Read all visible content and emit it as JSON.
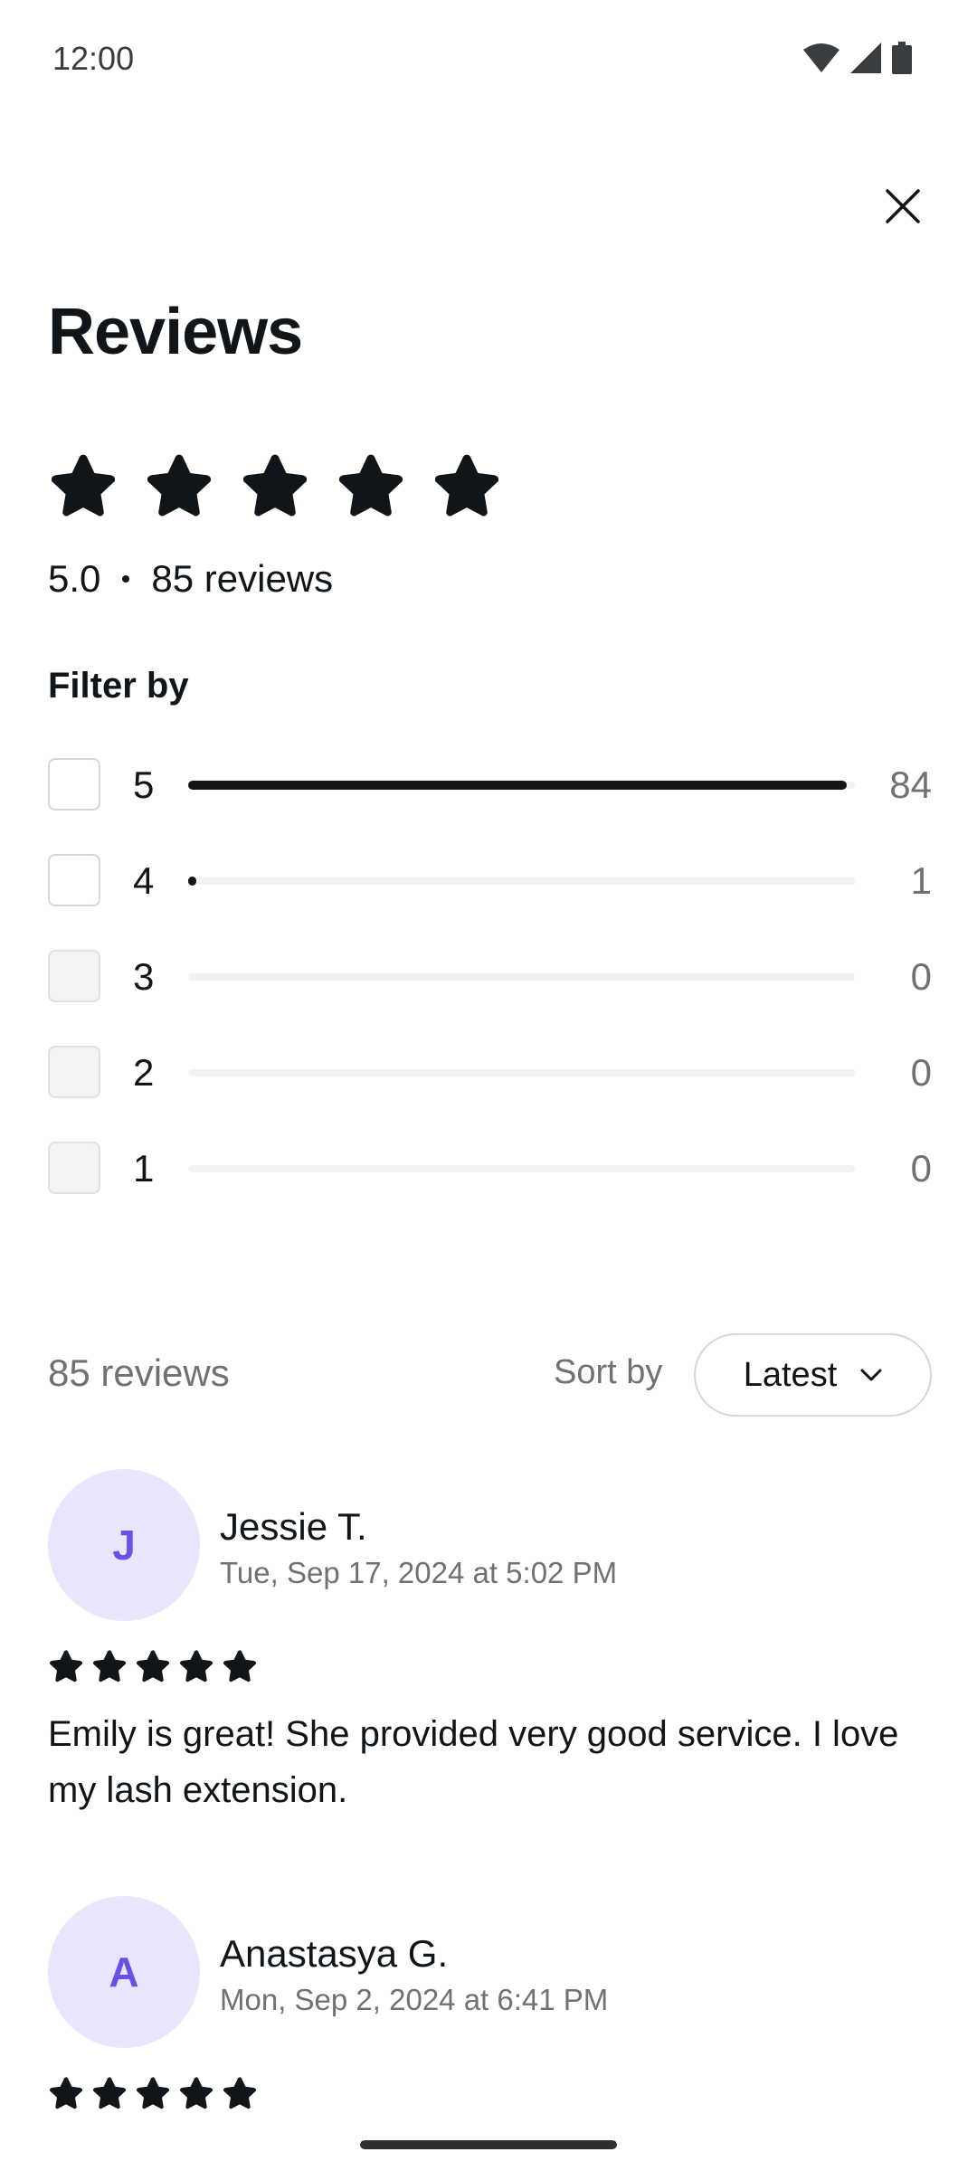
{
  "status": {
    "time": "12:00"
  },
  "header": {
    "title": "Reviews"
  },
  "rating_summary": {
    "rating": "5.0",
    "reviews_label": "85 reviews",
    "stars": 5
  },
  "filter": {
    "title": "Filter by",
    "rows": [
      {
        "stars": "5",
        "count": "84",
        "fraction": 0.988,
        "enabled": true
      },
      {
        "stars": "4",
        "count": "1",
        "fraction": 0.012,
        "enabled": true
      },
      {
        "stars": "3",
        "count": "0",
        "fraction": 0,
        "enabled": false
      },
      {
        "stars": "2",
        "count": "0",
        "fraction": 0,
        "enabled": false
      },
      {
        "stars": "1",
        "count": "0",
        "fraction": 0,
        "enabled": false
      }
    ]
  },
  "list": {
    "count_label": "85 reviews",
    "sort_label": "Sort by",
    "sort_value": "Latest"
  },
  "reviews": [
    {
      "initial": "J",
      "name": "Jessie T.",
      "date": "Tue, Sep 17, 2024 at 5:02 PM",
      "stars": 5,
      "text": "Emily is great! She provided very good service. I love my lash extension."
    },
    {
      "initial": "A",
      "name": "Anastasya G.",
      "date": "Mon, Sep 2, 2024 at 6:41 PM",
      "stars": 5,
      "text": ""
    }
  ],
  "colors": {
    "text": "#0f1518",
    "muted": "#6e7275",
    "avatar_bg": "#e7e6fd",
    "avatar_fg": "#6a4fe8"
  }
}
